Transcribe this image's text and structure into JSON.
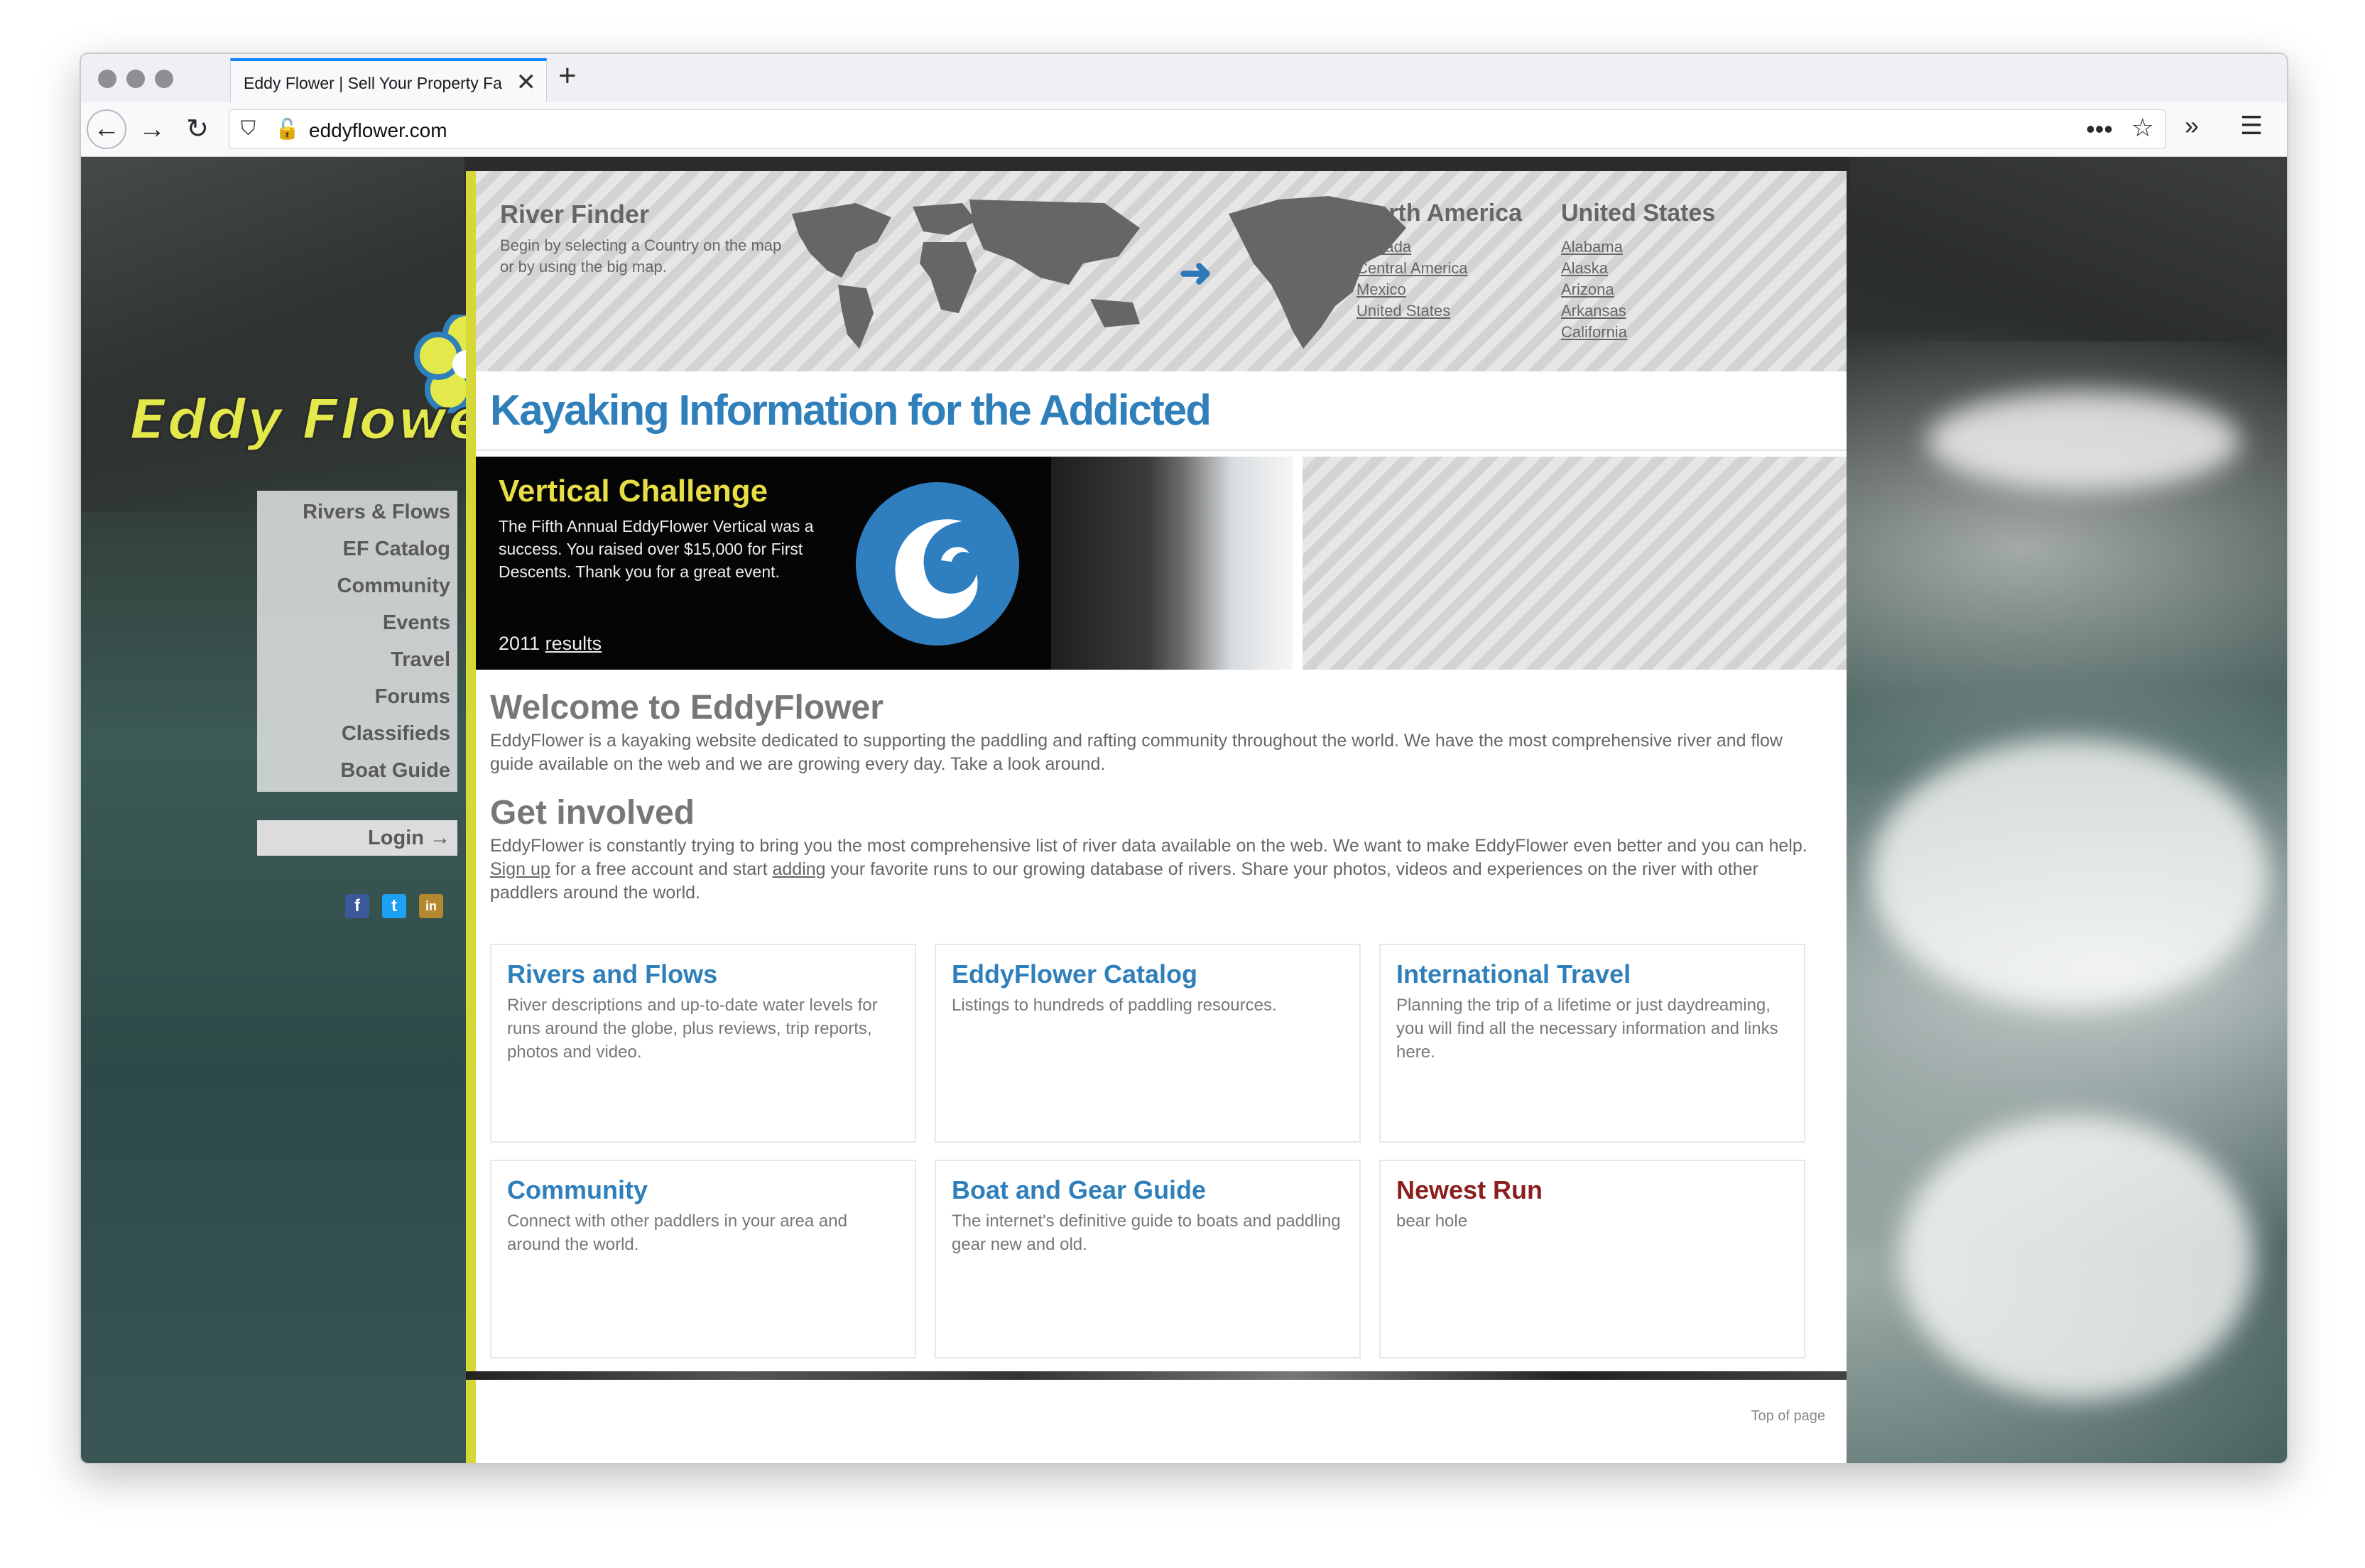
{
  "browser": {
    "tab_title": "Eddy Flower | Sell Your Property Fa",
    "url": "eddyflower.com"
  },
  "icons": [
    "back-icon",
    "forward-icon",
    "reload-icon",
    "shield-icon",
    "insecure-lock-icon",
    "more-icon",
    "star-icon",
    "overflow-icon",
    "menu-icon",
    "close-icon",
    "plus-icon"
  ],
  "river_finder": {
    "title": "River Finder",
    "description": "Begin by selecting a Country on the map or by using the big map.",
    "continent_title": "North America",
    "continent_list": [
      "Canada",
      "Central America",
      "Mexico",
      "United States"
    ],
    "country_title": "United States",
    "country_list": [
      "Alabama",
      "Alaska",
      "Arizona",
      "Arkansas",
      "California"
    ]
  },
  "headline": "Kayaking Information for the Addicted",
  "vertical_challenge": {
    "title": "Vertical Challenge",
    "text": "The Fifth Annual EddyFlower Vertical was a success. You raised over $15,000 for First Descents. Thank you for a great event.",
    "year": "2011",
    "results_link": "results"
  },
  "welcome": {
    "title": "Welcome to EddyFlower",
    "text": "EddyFlower is a kayaking website dedicated to supporting the paddling and rafting community throughout the world. We have the most comprehensive river and flow guide available on the web and we are growing every day. Take a look around."
  },
  "get_involved": {
    "title": "Get involved",
    "text_before": "EddyFlower is constantly trying to bring you the most comprehensive list of river data available on the web. We want to make EddyFlower even better and you can help.",
    "signup_link": "Sign up",
    "text_mid": "for a free account and start",
    "adding_link": "adding",
    "text_after": "your favorite runs to our growing database of rivers. Share your photos, videos and experiences on the river with other paddlers around the world."
  },
  "cards": [
    {
      "title": "Rivers and Flows",
      "text": "River descriptions and up-to-date water levels for runs around the globe, plus reviews, trip reports, photos and video."
    },
    {
      "title": "EddyFlower Catalog",
      "text": "Listings to hundreds of paddling resources."
    },
    {
      "title": "International Travel",
      "text": "Planning the trip of a lifetime or just daydreaming, you will find all the necessary information and links here."
    },
    {
      "title": "Community",
      "text": "Connect with other paddlers in your area and around the world."
    },
    {
      "title": "Boat and Gear Guide",
      "text": "The internet's definitive guide to boats and paddling gear new and old."
    },
    {
      "title": "Newest Run",
      "text": "bear hole"
    }
  ],
  "footer": {
    "top_of_page": "Top of page"
  },
  "sidebar": {
    "logo_text": "Eddy Flower",
    "nav": [
      "Rivers & Flows",
      "EF Catalog",
      "Community",
      "Events",
      "Travel",
      "Forums",
      "Classifieds",
      "Boat Guide"
    ],
    "login": "Login →",
    "social": [
      "f",
      "t",
      "in"
    ]
  },
  "colors": {
    "accent_blue": "#2f7fbb",
    "accent_yellow": "#d6d83a",
    "newest_run_red": "#8a1f1f",
    "firefox_tab_blue": "#0a84ff"
  }
}
